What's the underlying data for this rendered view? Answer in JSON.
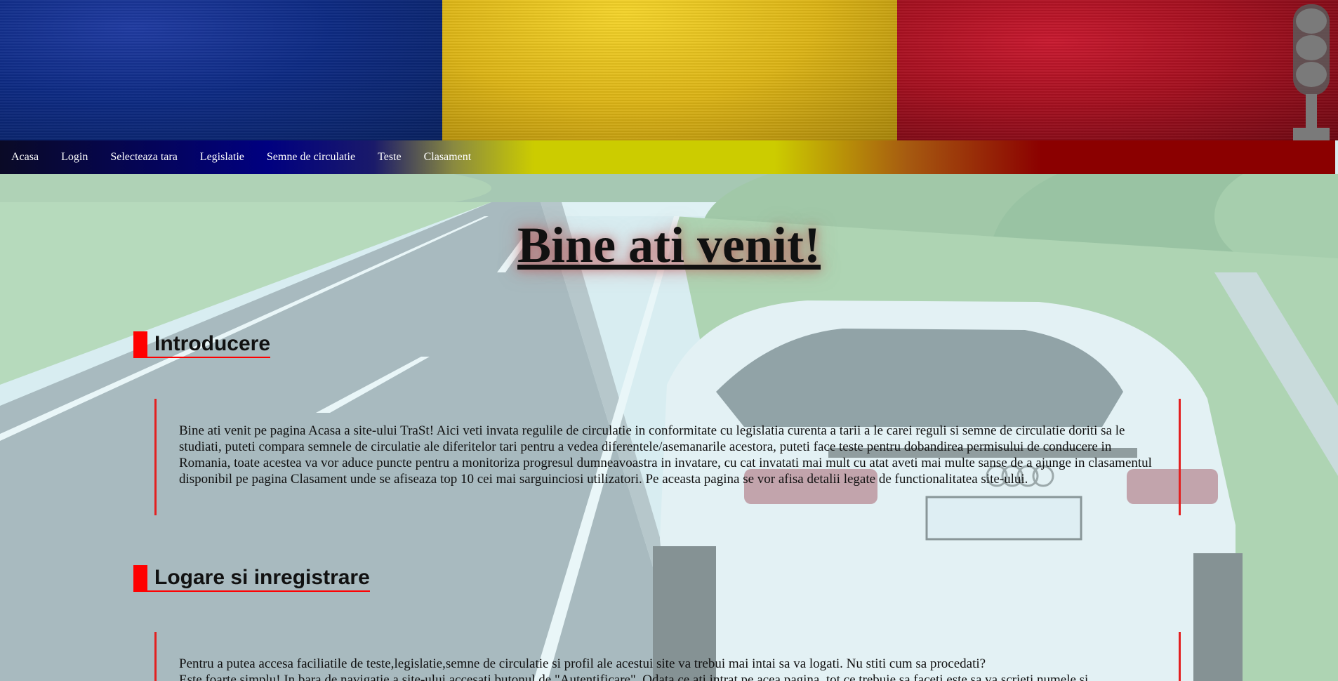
{
  "banner": {
    "flag_colors": [
      "#0d2a82",
      "#dbb315",
      "#a4101f"
    ],
    "right_icon": "traffic-light-icon"
  },
  "nav": {
    "items": [
      {
        "label": "Acasa"
      },
      {
        "label": "Login"
      },
      {
        "label": "Selecteaza tara"
      },
      {
        "label": "Legislatie"
      },
      {
        "label": "Semne de circulatie"
      },
      {
        "label": "Teste"
      },
      {
        "label": "Clasament"
      }
    ]
  },
  "main": {
    "title": "Bine ati venit!",
    "sections": [
      {
        "heading": "Introducere",
        "text": "Bine ati venit pe pagina Acasa a site-ului TraSt! Aici veti invata regulile de circulatie in conformitate cu legislatia curenta a tarii a le carei reguli si semne de circulatie doriti sa le studiati, puteti compara semnele de circulatie ale diferitelor tari pentru a vedea diferentele/asemanarile acestora, puteti face teste pentru dobandirea permisului de conducere in Romania, toate acestea va vor aduce puncte pentru a monitoriza progresul dumneavoastra in invatare, cu cat invatati mai mult cu atat aveti mai multe sanse de a ajunge in clasamentul disponibil pe pagina Clasament unde se afiseaza top 10 cei mai sarguinciosi utilizatori. Pe aceasta pagina se vor afisa detalii legate de functionalitatea site-ului."
      },
      {
        "heading": "Logare si inregistrare",
        "text": "Pentru a putea accesa faciliatile de teste,legislatie,semne de circulatie si profil ale acestui site va trebui mai intai sa va logati. Nu stiti cum sa procedati?",
        "text_line2": "Este foarte simplu! In bara de navigatie a site-ului accesati butonul de \"Autentificare\". Odata ce ati intrat pe acea pagina, tot ce trebuie sa faceti este sa va scrieti numele si"
      }
    ]
  },
  "colors": {
    "accent_red": "#ff0000",
    "nav_blue": "#000080",
    "nav_yellow": "#cccc00",
    "nav_red": "#8b0000"
  }
}
